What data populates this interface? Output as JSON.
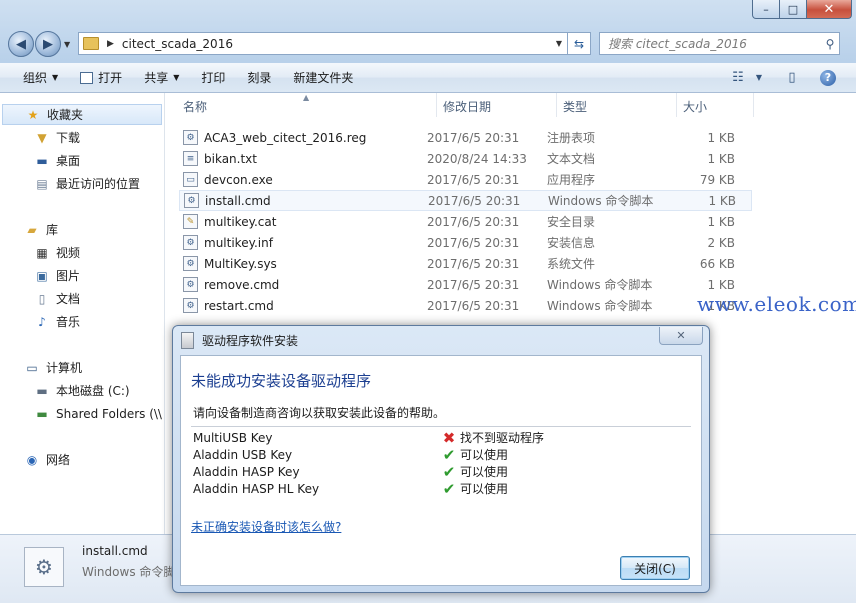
{
  "window": {
    "captions": {
      "min": "–",
      "max": "□",
      "close": "✕"
    }
  },
  "nav": {
    "back": "◀",
    "forward": "▶",
    "address_path": "citect_scada_2016",
    "search_placeholder": "搜索 citect_scada_2016"
  },
  "toolbar": {
    "organize": "组织",
    "open": "打开",
    "share": "共享",
    "print": "打印",
    "burn": "刻录",
    "new_folder": "新建文件夹"
  },
  "sidebar": {
    "favorites": "收藏夹",
    "downloads": "下载",
    "desktop": "桌面",
    "recent": "最近访问的位置",
    "libraries": "库",
    "videos": "视频",
    "pictures": "图片",
    "documents": "文档",
    "music": "音乐",
    "computer": "计算机",
    "local_disk": "本地磁盘 (C:)",
    "shared_folders": "Shared Folders (\\\\",
    "network": "网络"
  },
  "columns": {
    "name": "名称",
    "date": "修改日期",
    "type": "类型",
    "size": "大小"
  },
  "files": [
    {
      "name": "ACA3_web_citect_2016.reg",
      "date": "2017/6/5 20:31",
      "type": "注册表项",
      "size": "1 KB"
    },
    {
      "name": "bikan.txt",
      "date": "2020/8/24 14:33",
      "type": "文本文档",
      "size": "1 KB"
    },
    {
      "name": "devcon.exe",
      "date": "2017/6/5 20:31",
      "type": "应用程序",
      "size": "79 KB"
    },
    {
      "name": "install.cmd",
      "date": "2017/6/5 20:31",
      "type": "Windows 命令脚本",
      "size": "1 KB"
    },
    {
      "name": "multikey.cat",
      "date": "2017/6/5 20:31",
      "type": "安全目录",
      "size": "1 KB"
    },
    {
      "name": "multikey.inf",
      "date": "2017/6/5 20:31",
      "type": "安装信息",
      "size": "2 KB"
    },
    {
      "name": "MultiKey.sys",
      "date": "2017/6/5 20:31",
      "type": "系统文件",
      "size": "66 KB"
    },
    {
      "name": "remove.cmd",
      "date": "2017/6/5 20:31",
      "type": "Windows 命令脚本",
      "size": "1 KB"
    },
    {
      "name": "restart.cmd",
      "date": "2017/6/5 20:31",
      "type": "Windows 命令脚本",
      "size": "1 KB"
    }
  ],
  "watermark": "www.eleok.com",
  "details": {
    "name": "install.cmd",
    "type": "Windows 命令脚"
  },
  "dialog": {
    "title": "驱动程序软件安装",
    "heading": "未能成功安装设备驱动程序",
    "subtitle": "请向设备制造商咨询以获取安装此设备的帮助。",
    "devices": [
      {
        "name": "MultiUSB Key",
        "status": "找不到驱动程序",
        "ok": false
      },
      {
        "name": "Aladdin USB Key",
        "status": "可以使用",
        "ok": true
      },
      {
        "name": "Aladdin HASP Key",
        "status": "可以使用",
        "ok": true
      },
      {
        "name": "Aladdin HASP HL Key",
        "status": "可以使用",
        "ok": true
      }
    ],
    "help_link": "未正确安装设备时该怎么做?",
    "close_button": "关闭(C)"
  },
  "icons": {
    "favorites": "star-icon",
    "folder": "folder-icon",
    "computer": "computer-icon",
    "network": "network-icon",
    "error": "error-x-icon",
    "ok": "checkmark-icon"
  }
}
